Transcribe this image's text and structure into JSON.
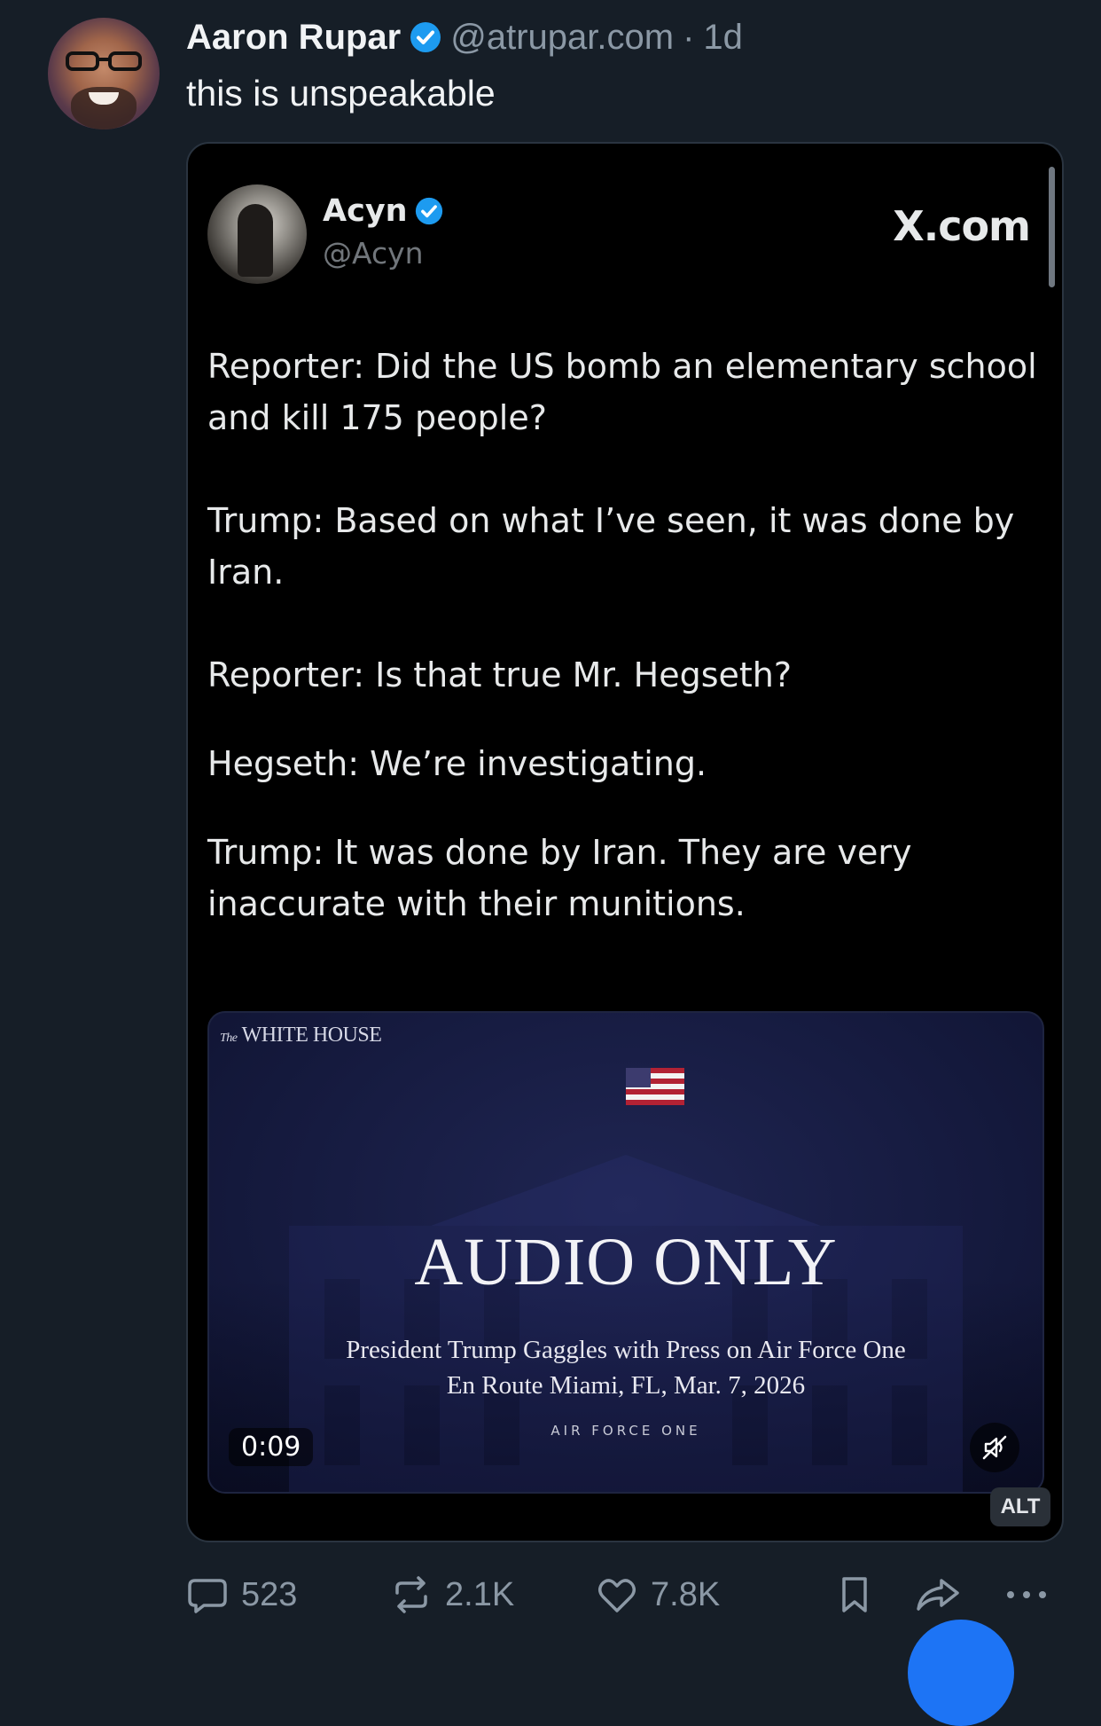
{
  "post": {
    "author_name": "Aaron Rupar",
    "handle": "@atrupar.com",
    "separator": "·",
    "time": "1d",
    "text": "this is unspeakable"
  },
  "embed": {
    "author_name": "Acyn",
    "handle": "@Acyn",
    "source": "X.com",
    "paragraphs": [
      "Reporter: Did the US bomb an elementary school and kill 175 people?",
      "Trump: Based on what I’ve seen, it was done by Iran.",
      "Reporter: Is that true Mr. Hegseth?",
      "Hegseth: We’re investigating.",
      "Trump: It was done by Iran. They are very inaccurate with their munitions."
    ],
    "video": {
      "label_prefix": "The",
      "label": "WHITE HOUSE",
      "title": "AUDIO ONLY",
      "subtitle_line1": "President Trump Gaggles with Press on Air Force One",
      "subtitle_line2": "En Route Miami, FL, Mar. 7, 2026",
      "brand": "AIR FORCE ONE",
      "duration": "0:09"
    }
  },
  "alt_badge": "ALT",
  "actions": {
    "replies": "523",
    "reposts": "2.1K",
    "likes": "7.8K"
  },
  "colors": {
    "background": "#161e27",
    "verified": "#1d9bf0",
    "muted_text": "#8b98a5",
    "fab": "#1d74f5"
  },
  "icons": [
    "verified-badge-icon",
    "flag-icon",
    "mute-icon",
    "reply-icon",
    "repost-icon",
    "like-icon",
    "bookmark-icon",
    "share-icon",
    "more-icon"
  ]
}
